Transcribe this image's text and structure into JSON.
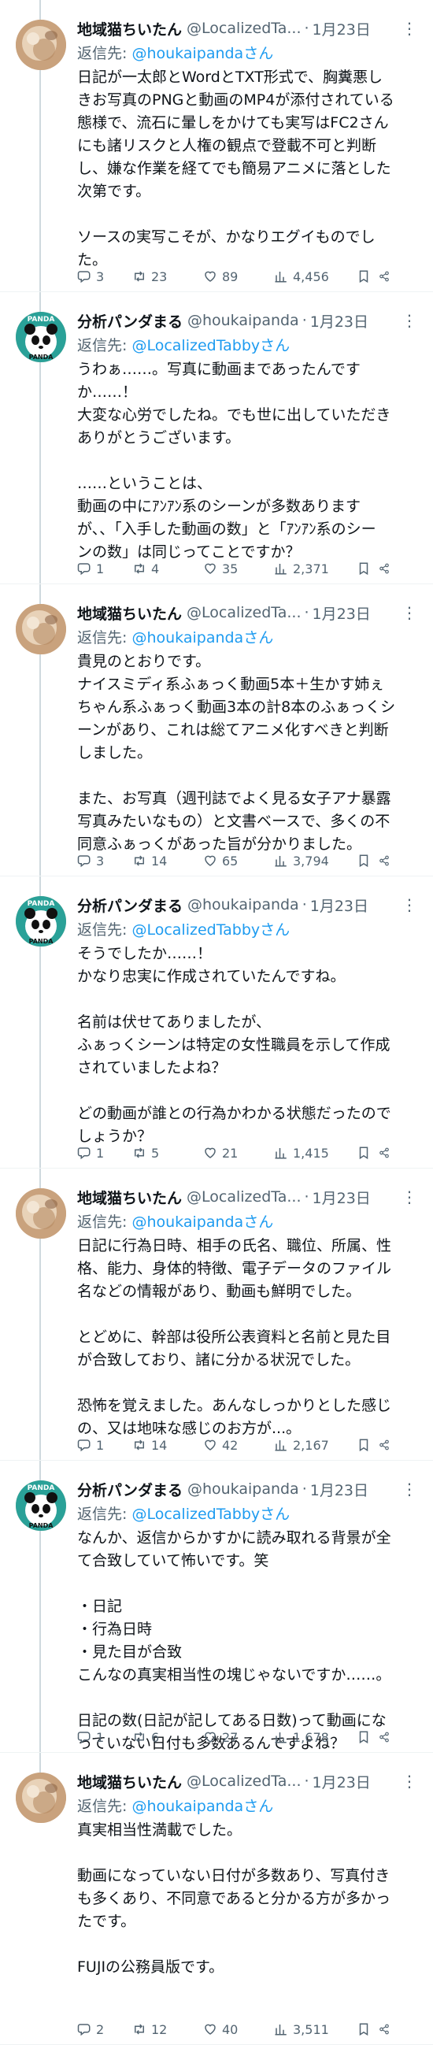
{
  "tweets": [
    {
      "user": "tabby",
      "name": "地域猫ちいたん",
      "handle": "@LocalizedTa...",
      "date": "1月23日",
      "reply_prefix": "返信先: ",
      "reply_to": "@houkaipandaさん",
      "body": "日記が一太郎とWordとTXT形式で、胸糞悪し\nきお写真のPNGと動画のMP4が添付されている\n態様で、流石に暈しをかけても実写はFC2さん\nにも諸リスクと人権の観点で登載不可と判断\nし、嫌な作業を経てでも簡易アニメに落とした\n次第です。\n\nソースの実写こそが、かなりエグイものでし\nた。",
      "replies": "3",
      "retweets": "23",
      "likes": "89",
      "views": "4,456"
    },
    {
      "user": "panda",
      "name": "分析パンダまる",
      "handle": "@houkaipanda",
      "date": "1月23日",
      "reply_prefix": "返信先: ",
      "reply_to": "@LocalizedTabbyさん",
      "body": "うわぁ……。写真に動画まであったんです\nか……！\n大変な心労でしたね。でも世に出していただき\nありがとうございます。\n\n……ということは、\n動画の中にｱﾝｱﾝ系のシーンが多数あります\nが、、「入手した動画の数」と「ｱﾝｱﾝ系のシー\nンの数」は同じってことですか？",
      "replies": "1",
      "retweets": "4",
      "likes": "35",
      "views": "2,371"
    },
    {
      "user": "tabby",
      "name": "地域猫ちいたん",
      "handle": "@LocalizedTa...",
      "date": "1月23日",
      "reply_prefix": "返信先: ",
      "reply_to": "@houkaipandaさん",
      "body": "貴見のとおりです。\nナイスミディ系ふぁっく動画5本＋生かす姉ぇ\nちゃん系ふぁっく動画3本の計8本のふぁっくシ\nーンがあり、これは総てアニメ化すべきと判断\nしました。\n\nまた、お写真（週刊誌でよく見る女子アナ暴露\n写真みたいなもの）と文書ベースで、多くの不\n同意ふぁっくがあった旨が分かりました。",
      "replies": "3",
      "retweets": "14",
      "likes": "65",
      "views": "3,794"
    },
    {
      "user": "panda",
      "name": "分析パンダまる",
      "handle": "@houkaipanda",
      "date": "1月23日",
      "reply_prefix": "返信先: ",
      "reply_to": "@LocalizedTabbyさん",
      "body": "そうでしたか……！\nかなり忠実に作成されていたんですね。\n\n名前は伏せてありましたが、\nふぁっくシーンは特定の女性職員を示して作成\nされていましたよね？\n\nどの動画が誰との行為かわかる状態だったので\nしょうか？",
      "replies": "1",
      "retweets": "5",
      "likes": "21",
      "views": "1,415"
    },
    {
      "user": "tabby",
      "name": "地域猫ちいたん",
      "handle": "@LocalizedTa...",
      "date": "1月23日",
      "reply_prefix": "返信先: ",
      "reply_to": "@houkaipandaさん",
      "body": "日記に行為日時、相手の氏名、職位、所属、性\n格、能力、身体的特徴、電子データのファイル\n名などの情報があり、動画も鮮明でした。\n\nとどめに、幹部は役所公表資料と名前と見た目\nが合致しており、諸に分かる状況でした。\n\n恐怖を覚えました。あんなしっかりとした感じ\nの、又は地味な感じのお方が...。",
      "replies": "1",
      "retweets": "14",
      "likes": "42",
      "views": "2,167"
    },
    {
      "user": "panda",
      "name": "分析パンダまる",
      "handle": "@houkaipanda",
      "date": "1月23日",
      "reply_prefix": "返信先: ",
      "reply_to": "@LocalizedTabbyさん",
      "body": "なんか、返信からかすかに読み取れる背景が全\nて合致していて怖いです。笑\n\n・日記\n・行為日時\n・見た目が合致\nこんなの真実相当性の塊じゃないですか……。\n\n日記の数(日記が記してある日数)って動画にな\nっていない日付も多数あるんですよね？",
      "replies": "1",
      "retweets": "6",
      "likes": "27",
      "views": "1,678"
    },
    {
      "user": "tabby",
      "name": "地域猫ちいたん",
      "handle": "@LocalizedTa...",
      "date": "1月23日",
      "reply_prefix": "返信先: ",
      "reply_to": "@houkaipandaさん",
      "body": "真実相当性満載でした。\n\n動画になっていない日付が多数あり、写真付き\nも多くあり、不同意であると分かる方が多かっ\nたです。\n\nFUJIの公務員版です。",
      "replies": "2",
      "retweets": "12",
      "likes": "40",
      "views": "3,511"
    }
  ],
  "avatar_text": {
    "panda_top": "PANDA",
    "panda_bottom": "PANDA"
  },
  "colors": {
    "link": "#1d9bf0",
    "secondary": "#536471",
    "text": "#0f1419",
    "thread": "#cfd9de"
  },
  "icons": {
    "reply": "reply-icon",
    "retweet": "retweet-icon",
    "like": "heart-icon",
    "views": "views-icon",
    "bookmark": "bookmark-icon",
    "share": "share-icon",
    "more": "more-icon"
  }
}
